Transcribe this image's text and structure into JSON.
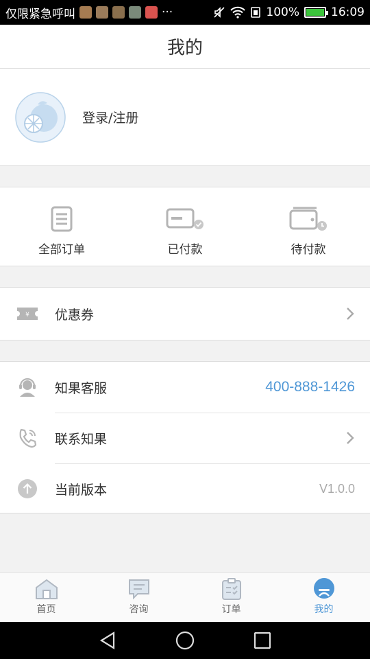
{
  "status_bar": {
    "carrier_text": "仅限紧急呼叫",
    "battery": "100%",
    "time": "16:09",
    "more": "···"
  },
  "header": {
    "title": "我的"
  },
  "profile": {
    "login_label": "登录/注册"
  },
  "orders": [
    {
      "label": "全部订单",
      "icon": "all-orders-icon"
    },
    {
      "label": "已付款",
      "icon": "paid-icon"
    },
    {
      "label": "待付款",
      "icon": "pending-payment-icon"
    }
  ],
  "coupon": {
    "label": "优惠券",
    "icon": "coupon-icon"
  },
  "list": {
    "service": {
      "label": "知果客服",
      "phone": "400-888-1426"
    },
    "contact": {
      "label": "联系知果"
    },
    "version": {
      "label": "当前版本",
      "value": "V1.0.0"
    }
  },
  "tabs": [
    {
      "label": "首页",
      "icon": "home-icon",
      "active": false
    },
    {
      "label": "咨询",
      "icon": "chat-icon",
      "active": false
    },
    {
      "label": "订单",
      "icon": "clipboard-icon",
      "active": false
    },
    {
      "label": "我的",
      "icon": "user-icon",
      "active": true
    }
  ],
  "colors": {
    "accent": "#4f97d6",
    "icon_gray": "#b5b5b5",
    "text": "#333333"
  }
}
